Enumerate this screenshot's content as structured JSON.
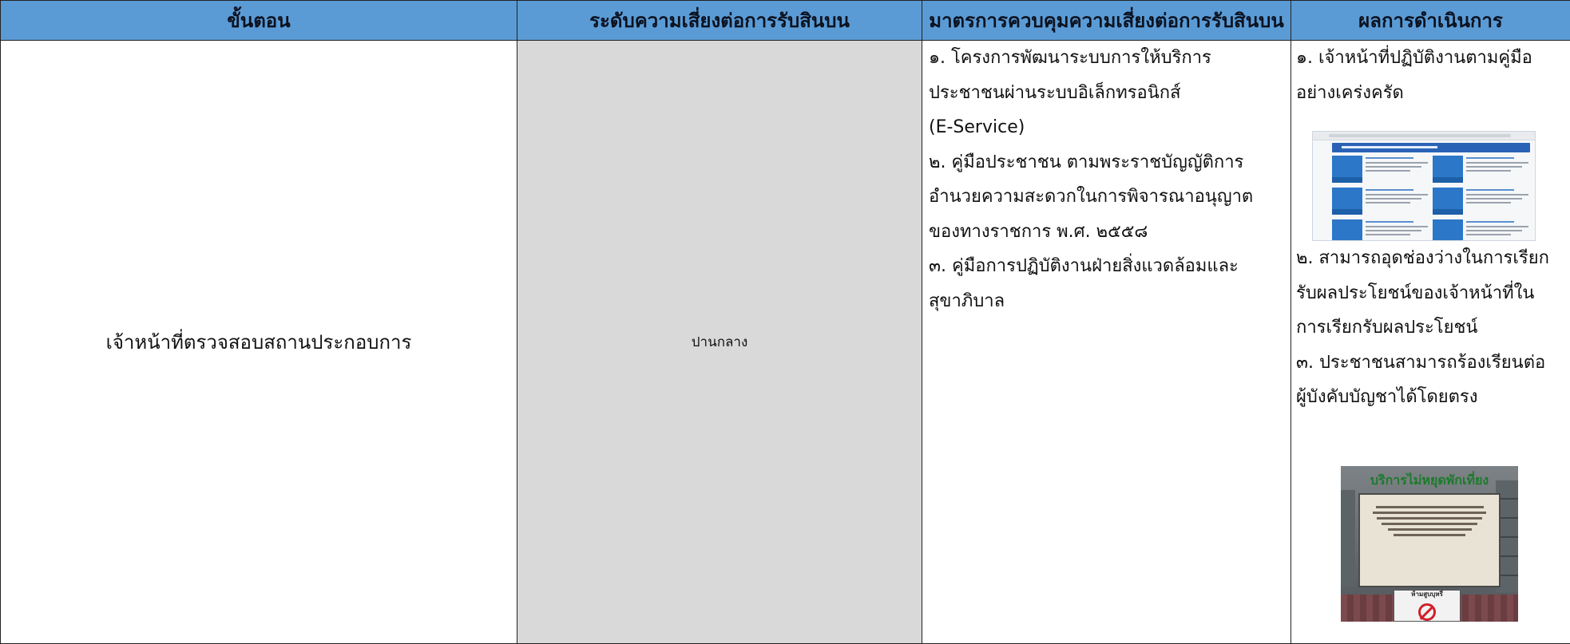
{
  "table": {
    "headers": [
      "ขั้นตอน",
      "ระดับความเสี่ยงต่อการรับสินบน",
      "มาตรการควบคุมความเสี่ยงต่อการรับสินบน",
      "ผลการดำเนินการ"
    ],
    "row": {
      "step": "เจ้าหน้าที่ตรวจสอบสถานประกอบการ",
      "risk_level": "ปานกลาง",
      "measures": [
        "๑. โครงการพัฒนาระบบการให้บริการ",
        "ประชาชนผ่านระบบอิเล็กทรอนิกส์",
        "(E-Service)",
        "๒. คู่มือประชาชน ตามพระราชบัญญัติการ",
        "อำนวยความสะดวกในการพิจารณาอนุญาต",
        "ของทางราชการ พ.ศ. ๒๕๕๘",
        "๓. คู่มือการปฏิบัติงานฝ่ายสิ่งแวดล้อมและ",
        "สุขาภิบาล"
      ],
      "results_top": [
        "๑. เจ้าหน้าที่ปฏิบัติงานตามคู่มือ",
        "อย่างเคร่งครัด"
      ],
      "results_bottom": [
        "๒. สามารถอุดช่องว่างในการเรียก",
        "รับผลประโยชน์ของเจ้าหน้าที่ใน",
        "การเรียกรับผลประโยชน์",
        "๓. ประชาชนสามารถร้องเรียนต่อ",
        "ผู้บังคับบัญชาได้โดยตรง"
      ],
      "photo_sign": {
        "banner": "บริการไม่หยุดพักเที่ยง",
        "no_smoking": "ห้ามสูบบุหรี่"
      }
    }
  },
  "colors": {
    "header_bg": "#5b9bd5",
    "risk_cell_bg": "#d9d9d9",
    "border": "#222222"
  }
}
